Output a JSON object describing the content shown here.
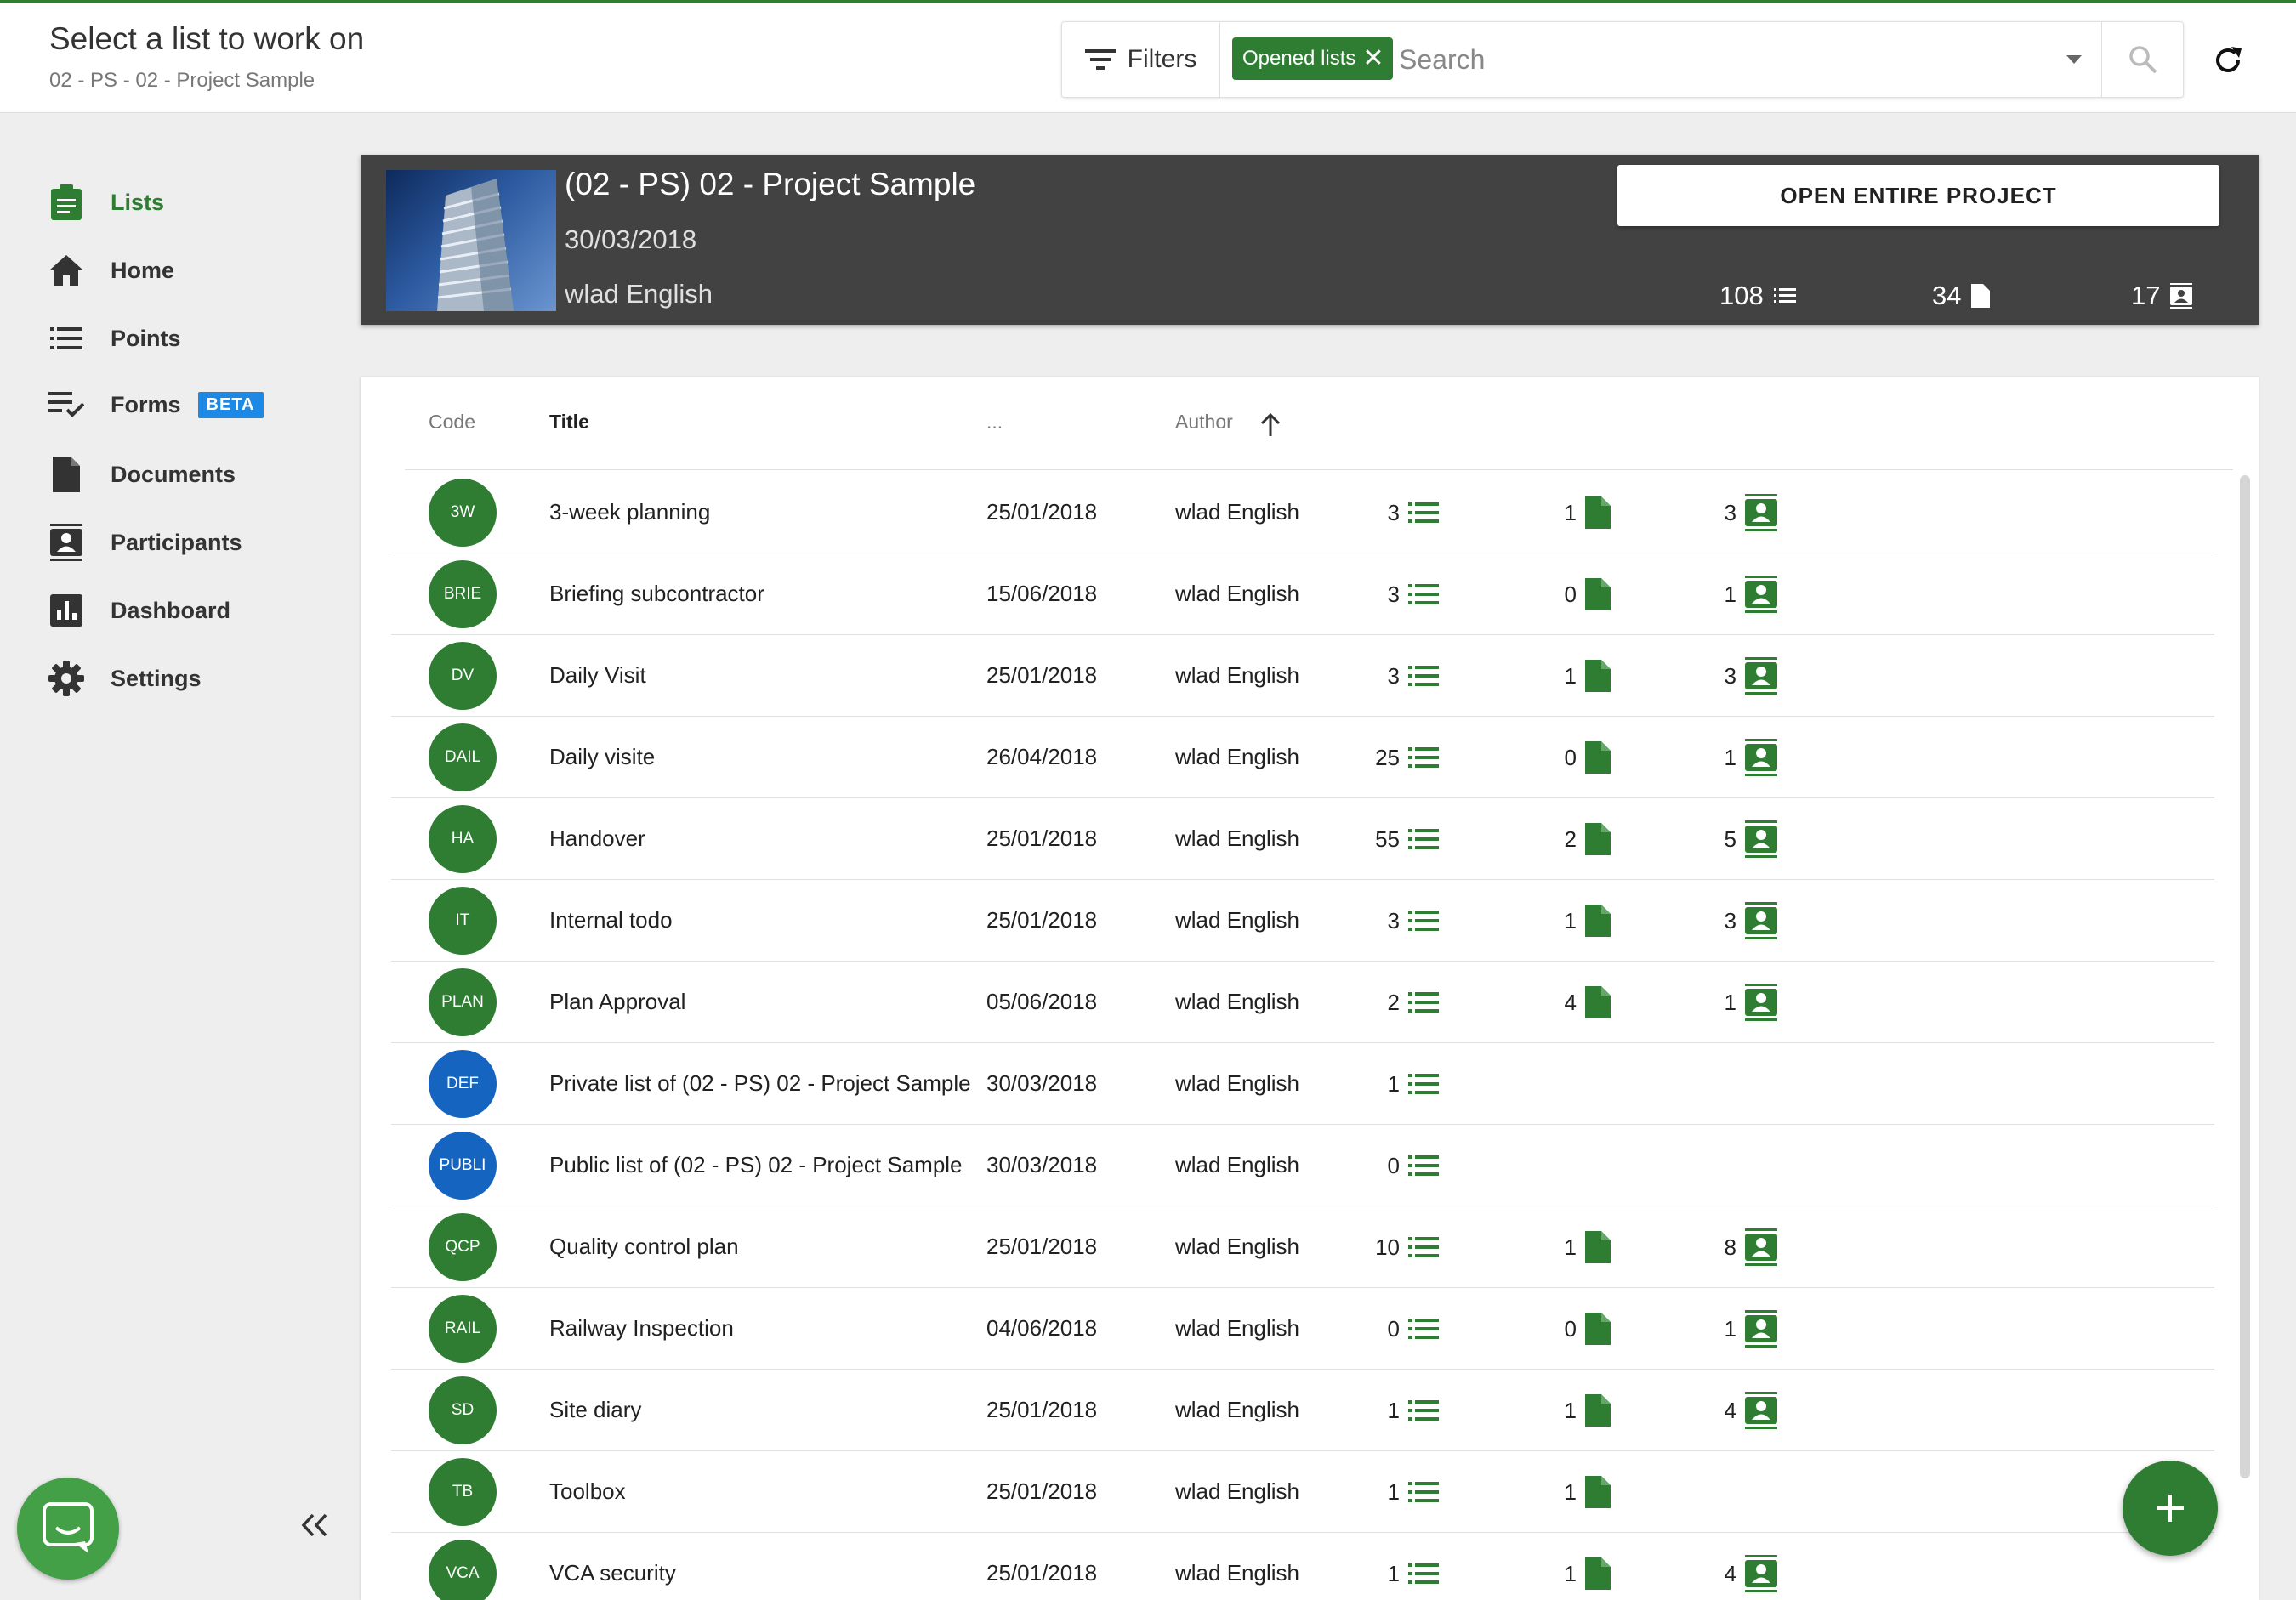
{
  "header": {
    "title": "Select a list to work on",
    "subtitle": "02 - PS - 02 - Project Sample",
    "filters_label": "Filters",
    "chip_label": "Opened lists",
    "search_placeholder": "Search"
  },
  "sidebar": {
    "items": [
      {
        "label": "Lists",
        "icon": "clipboard-icon",
        "active": true
      },
      {
        "label": "Home",
        "icon": "home-icon"
      },
      {
        "label": "Points",
        "icon": "list-icon"
      },
      {
        "label": "Forms",
        "icon": "checklist-icon",
        "badge": "BETA"
      },
      {
        "label": "Documents",
        "icon": "document-icon"
      },
      {
        "label": "Participants",
        "icon": "contacts-icon"
      },
      {
        "label": "Dashboard",
        "icon": "chart-icon"
      },
      {
        "label": "Settings",
        "icon": "gear-icon"
      }
    ]
  },
  "project": {
    "title": "(02 - PS) 02 - Project Sample",
    "date": "30/03/2018",
    "author": "wlad English",
    "open_button": "OPEN ENTIRE PROJECT",
    "points": "108",
    "documents": "34",
    "participants": "17"
  },
  "table": {
    "headers": {
      "code": "Code",
      "title": "Title",
      "date": "...",
      "author": "Author"
    },
    "rows": [
      {
        "code": "3W",
        "title": "3-week planning",
        "date": "25/01/2018",
        "author": "wlad English",
        "points": "3",
        "docs": "1",
        "participants": "3"
      },
      {
        "code": "BRIE",
        "title": "Briefing subcontractor",
        "date": "15/06/2018",
        "author": "wlad English",
        "points": "3",
        "docs": "0",
        "participants": "1"
      },
      {
        "code": "DV",
        "title": "Daily Visit",
        "date": "25/01/2018",
        "author": "wlad English",
        "points": "3",
        "docs": "1",
        "participants": "3"
      },
      {
        "code": "DAIL",
        "title": "Daily visite",
        "date": "26/04/2018",
        "author": "wlad English",
        "points": "25",
        "docs": "0",
        "participants": "1"
      },
      {
        "code": "HA",
        "title": "Handover",
        "date": "25/01/2018",
        "author": "wlad English",
        "points": "55",
        "docs": "2",
        "participants": "5"
      },
      {
        "code": "IT",
        "title": "Internal todo",
        "date": "25/01/2018",
        "author": "wlad English",
        "points": "3",
        "docs": "1",
        "participants": "3"
      },
      {
        "code": "PLAN",
        "title": "Plan Approval",
        "date": "05/06/2018",
        "author": "wlad English",
        "points": "2",
        "docs": "4",
        "participants": "1"
      },
      {
        "code": "DEF",
        "title": "Private list of (02 - PS) 02 - Project Sample",
        "date": "30/03/2018",
        "author": "wlad English",
        "points": "1",
        "color": "blue"
      },
      {
        "code": "PUBLI",
        "title": "Public list of (02 - PS) 02 - Project Sample",
        "date": "30/03/2018",
        "author": "wlad English",
        "points": "0",
        "color": "blue"
      },
      {
        "code": "QCP",
        "title": "Quality control plan",
        "date": "25/01/2018",
        "author": "wlad English",
        "points": "10",
        "docs": "1",
        "participants": "8"
      },
      {
        "code": "RAIL",
        "title": "Railway Inspection",
        "date": "04/06/2018",
        "author": "wlad English",
        "points": "0",
        "docs": "0",
        "participants": "1"
      },
      {
        "code": "SD",
        "title": "Site diary",
        "date": "25/01/2018",
        "author": "wlad English",
        "points": "1",
        "docs": "1",
        "participants": "4"
      },
      {
        "code": "TB",
        "title": "Toolbox",
        "date": "25/01/2018",
        "author": "wlad English",
        "points": "1",
        "docs": "1"
      },
      {
        "code": "VCA",
        "title": "VCA security",
        "date": "25/01/2018",
        "author": "wlad English",
        "points": "1",
        "docs": "1",
        "participants": "4"
      }
    ]
  },
  "colors": {
    "accent": "#2e7d32",
    "blue_avatar": "#1565c0",
    "beta": "#1e88e5",
    "card_dark": "#424242"
  }
}
